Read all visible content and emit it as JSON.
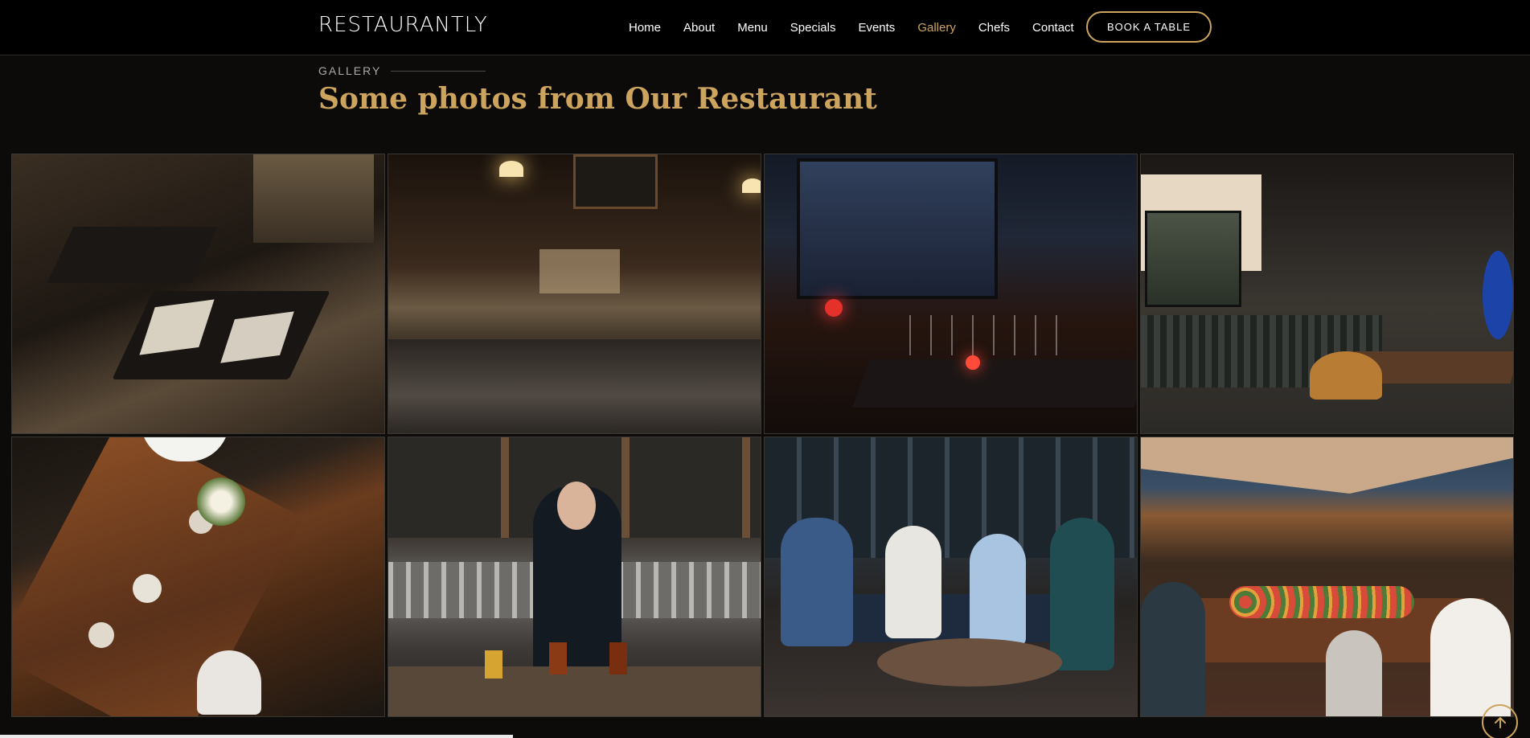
{
  "header": {
    "logo": "RESTAURANTLY",
    "nav": [
      {
        "label": "Home",
        "active": false
      },
      {
        "label": "About",
        "active": false
      },
      {
        "label": "Menu",
        "active": false
      },
      {
        "label": "Specials",
        "active": false
      },
      {
        "label": "Events",
        "active": false
      },
      {
        "label": "Gallery",
        "active": true
      },
      {
        "label": "Chefs",
        "active": false
      },
      {
        "label": "Contact",
        "active": false
      }
    ],
    "book_button": "BOOK A TABLE"
  },
  "section": {
    "kicker": "GALLERY",
    "heading": "Some photos from Our Restaurant"
  },
  "gallery": {
    "items": [
      {
        "name": "gallery-photo-dining-room-tables"
      },
      {
        "name": "gallery-photo-pub-interior"
      },
      {
        "name": "gallery-photo-wine-glasses-table"
      },
      {
        "name": "gallery-photo-bar-shelf-counter"
      },
      {
        "name": "gallery-photo-overhead-table-dinner"
      },
      {
        "name": "gallery-photo-bartender-beer-flight"
      },
      {
        "name": "gallery-photo-friends-patio"
      },
      {
        "name": "gallery-photo-outdoor-tent-toast"
      }
    ]
  },
  "colors": {
    "accent": "#cda45e",
    "background": "#0c0b09",
    "header_bg": "#000000"
  },
  "icons": {
    "back_to_top": "arrow-up-icon"
  }
}
